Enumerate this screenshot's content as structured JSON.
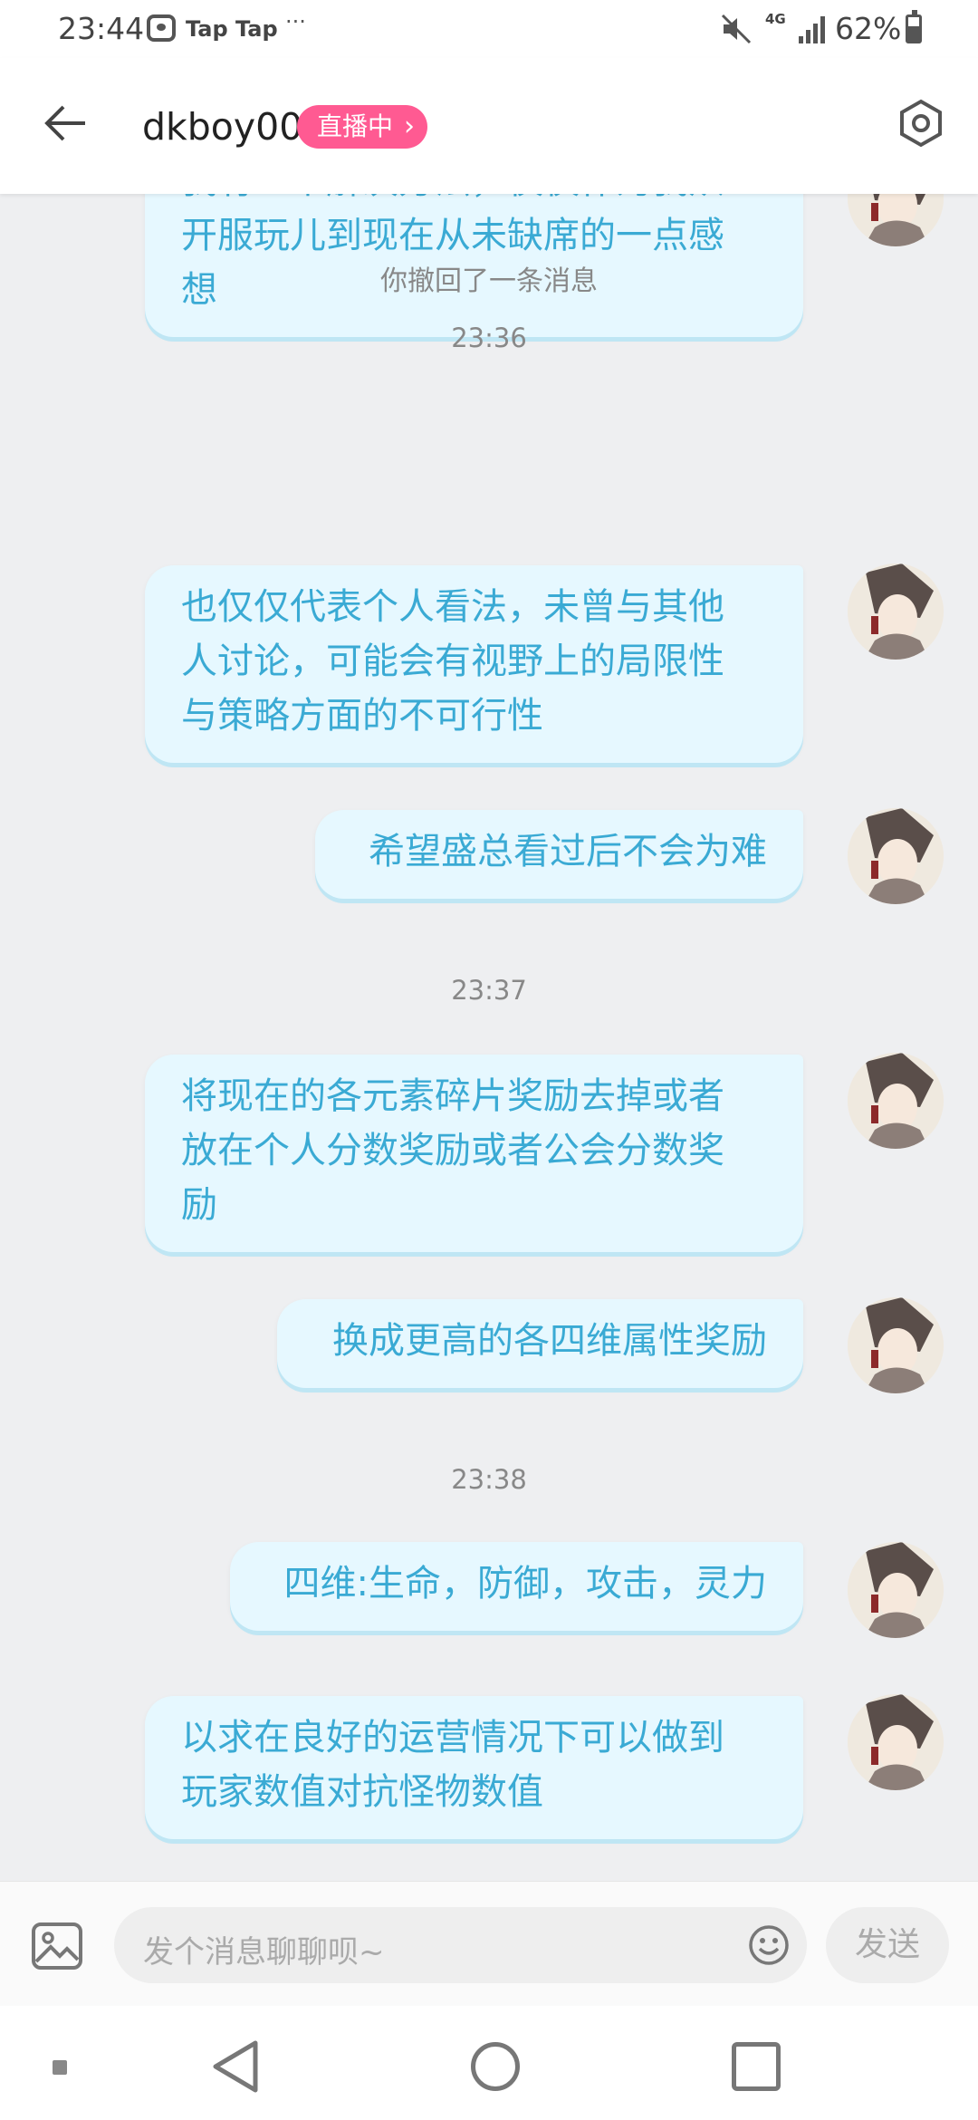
{
  "status_bar": {
    "time": "23:44",
    "app_name": "Tap Tap",
    "more": "···",
    "network": "4G",
    "battery": "62%",
    "icons": [
      "taptap-icon",
      "mute-icon",
      "signal-icon",
      "battery-icon"
    ]
  },
  "header": {
    "title": "dkboy00",
    "live_badge": "直播中",
    "live_chevron": "›",
    "icons": [
      "back-arrow-icon",
      "settings-hex-icon"
    ]
  },
  "colors": {
    "bubble_bg": "#e6f8ff",
    "bubble_text": "#3aaad4",
    "live_badge": "#ff5a92",
    "chat_bg": "#eeeff1"
  },
  "chat": {
    "bubble_partial": "我有一个解决方法，仅仅作为我从\n开服玩儿到现在从未缺席的一点感\n想",
    "recall_notice": "你撤回了一条消息",
    "time_1": "23:36",
    "bubble_1": "也仅仅代表个人看法，未曾与其他\n人讨论，可能会有视野上的局限性\n与策略方面的不可行性",
    "bubble_2": "希望盛总看过后不会为难",
    "time_2": "23:37",
    "bubble_3": "将现在的各元素碎片奖励去掉或者\n放在个人分数奖励或者公会分数奖\n励",
    "bubble_4": "换成更高的各四维属性奖励",
    "time_3": "23:38",
    "bubble_5": "四维:生命，防御，攻击，灵力",
    "bubble_6": "以求在良好的运营情况下可以做到\n玩家数值对抗怪物数值"
  },
  "input_bar": {
    "placeholder": "发个消息聊聊呗~",
    "send_label": "发送",
    "icons": [
      "image-icon",
      "emoji-icon"
    ]
  },
  "nav_bar": {
    "icons": [
      "recents-dot-icon",
      "back-triangle-icon",
      "home-circle-icon",
      "overview-square-icon"
    ]
  }
}
